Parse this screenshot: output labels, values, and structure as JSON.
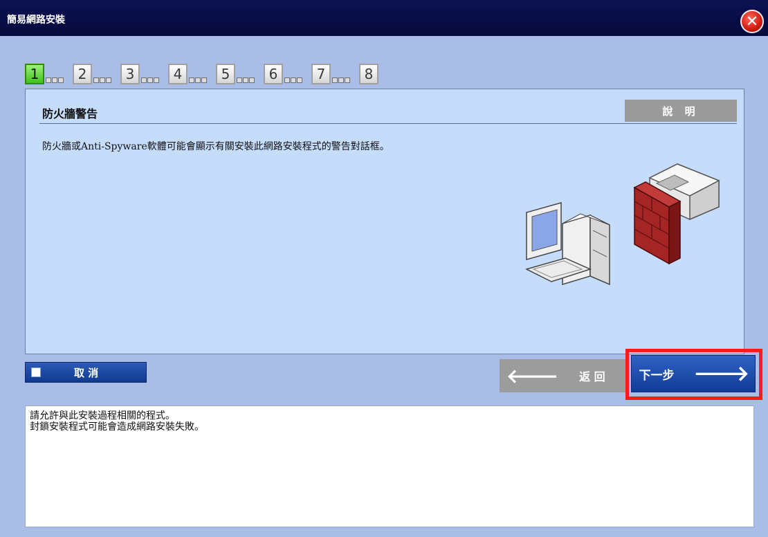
{
  "window": {
    "title": "簡易網路安裝"
  },
  "steps": [
    {
      "num": "1",
      "active": true
    },
    {
      "num": "2",
      "active": false
    },
    {
      "num": "3",
      "active": false
    },
    {
      "num": "4",
      "active": false
    },
    {
      "num": "5",
      "active": false
    },
    {
      "num": "6",
      "active": false
    },
    {
      "num": "7",
      "active": false
    },
    {
      "num": "8",
      "active": false
    }
  ],
  "panel": {
    "heading": "防火牆警告",
    "help_label": "說 明",
    "description": "防火牆或Anti-Spyware軟體可能會顯示有關安裝此網路安裝程式的警告對話框。"
  },
  "buttons": {
    "cancel_label": "取 消",
    "back_label": "返 回",
    "next_label": "下一步"
  },
  "message": {
    "line1": "請允許與此安裝過程相關的程式。",
    "line2": "封鎖安裝程式可能會造成網路安裝失敗。"
  },
  "colors": {
    "titlebar": "#0c1152",
    "background": "#a9bde6",
    "panel": "#c6dcfb",
    "highlight": "#ff1a1a",
    "active_step": "#3ec21a"
  }
}
